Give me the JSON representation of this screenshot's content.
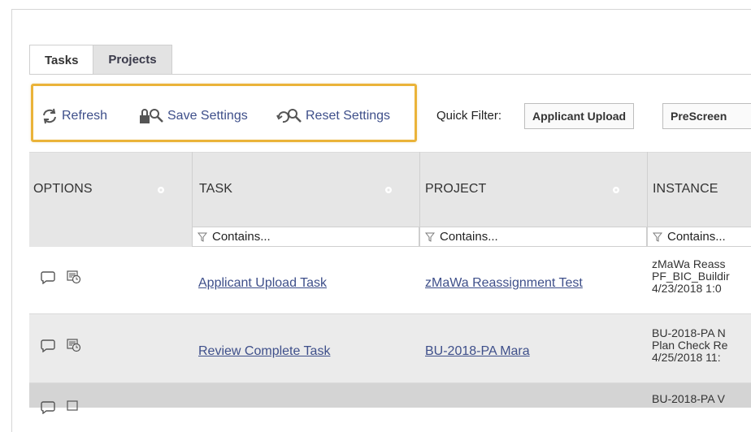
{
  "tabs": [
    {
      "label": "Tasks"
    },
    {
      "label": "Projects"
    }
  ],
  "toolbar": {
    "refresh_label": "Refresh",
    "save_label": "Save Settings",
    "reset_label": "Reset Settings",
    "highlight_color": "#eab339",
    "link_color": "#3e4f8a"
  },
  "quick_filter": {
    "label": "Quick Filter:",
    "buttons": [
      "Applicant Upload",
      "PreScreen"
    ]
  },
  "grid": {
    "columns": [
      "OPTIONS",
      "TASK",
      "PROJECT",
      "INSTANCE"
    ],
    "filter_placeholder": "Contains...",
    "rows": [
      {
        "task": "Applicant Upload Task",
        "project": "zMaWa Reassignment Test",
        "instance": [
          "zMaWa Reass",
          "PF_BIC_Buildir",
          "4/23/2018 1:0"
        ]
      },
      {
        "task": "Review Complete Task",
        "project": "BU-2018-PA Mara",
        "instance": [
          "BU-2018-PA N",
          "Plan Check Re",
          "4/25/2018 11:"
        ]
      },
      {
        "task": "",
        "project": "",
        "instance": [
          "BU-2018-PA V",
          "",
          ""
        ]
      }
    ]
  }
}
